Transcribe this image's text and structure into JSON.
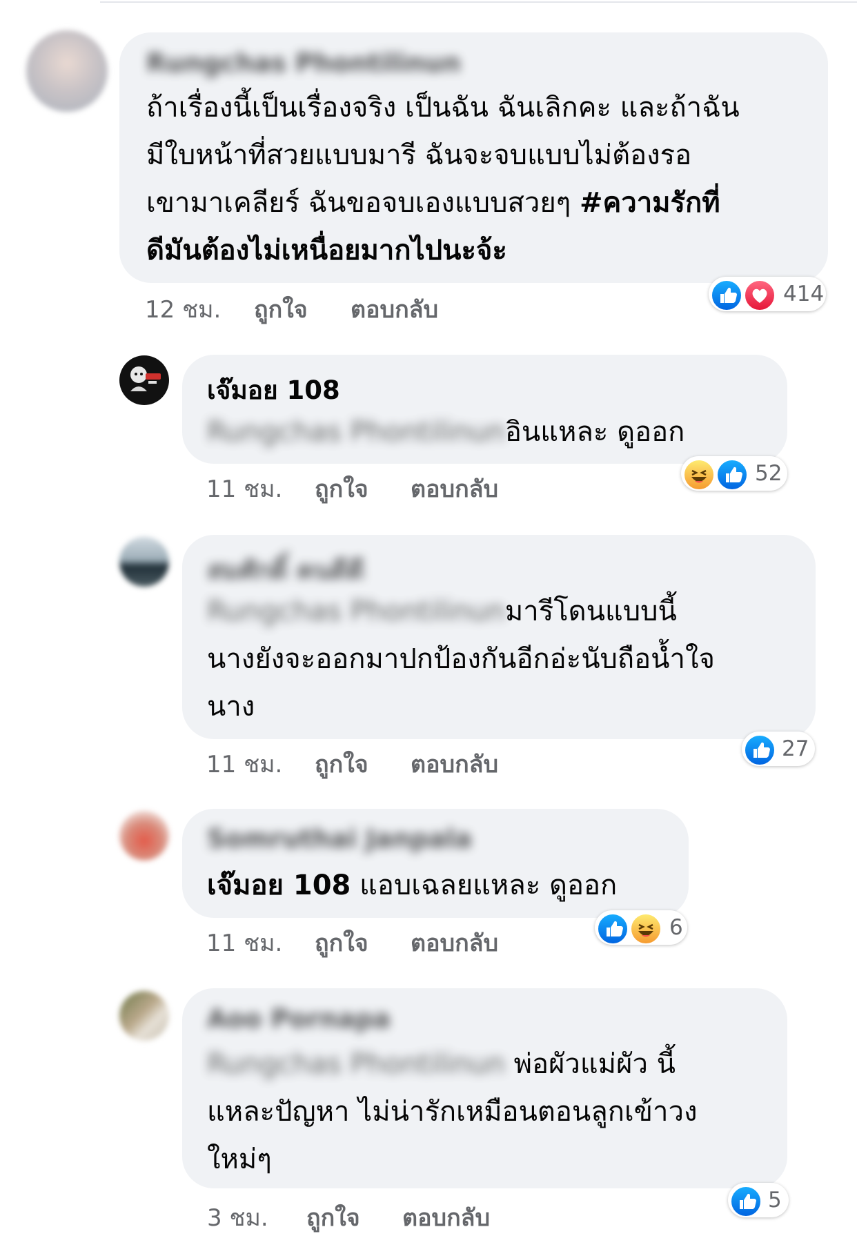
{
  "comments": [
    {
      "author": "Rungchas Phontilinun",
      "text_lines": [
        "ถ้าเรื่องนี้เป็นเรื่องจริง เป็นฉัน ฉันเลิกคะ และถ้าฉัน",
        "มีใบหน้าที่สวยแบบมารี ฉันจะจบแบบไม่ต้องรอ",
        "เขามาเคลียร์ ฉันขอจบเองแบบสวยๆ "
      ],
      "hashtag_line1": "#ความรักที่",
      "hashtag_line2": "ดีมันต้องไม่เหนื่อยมากไปนะจ้ะ",
      "time": "12 ชม.",
      "like": "ถูกใจ",
      "reply": "ตอบกลับ",
      "reactions": [
        "like-icon",
        "love-icon"
      ],
      "count": "414"
    },
    {
      "author": "เจ๊มอย 108",
      "mention": "Rungchas Phontilinun",
      "text": "อินแหละ ดูออก",
      "time": "11 ชม.",
      "like": "ถูกใจ",
      "reply": "ตอบกลับ",
      "reactions": [
        "haha-icon",
        "like-icon"
      ],
      "count": "52"
    },
    {
      "author": "สมศักดิ์ คนดีดี",
      "mention": "Rungchas Phontilinun",
      "text_first": "มารีโดนแบบนี้",
      "text_lines": [
        "นางยังจะออกมาปกป้องกันอีกอ่ะนับถือน้ำใจ",
        "นาง"
      ],
      "time": "11 ชม.",
      "like": "ถูกใจ",
      "reply": "ตอบกลับ",
      "reactions": [
        "like-icon"
      ],
      "count": "27"
    },
    {
      "author": "Somruthai Janpala",
      "mention": "เจ๊มอย 108",
      "text": " แอบเฉลยแหละ ดูออก",
      "time": "11 ชม.",
      "like": "ถูกใจ",
      "reply": "ตอบกลับ",
      "reactions": [
        "like-icon",
        "haha-icon"
      ],
      "count": "6"
    },
    {
      "author": "Aoo Pornapa",
      "mention": "Rungchas Phontilinun",
      "text_first": " พ่อผัวแม่ผัว นี้",
      "text_lines": [
        "แหละปัญหา  ไม่น่ารักเหมือนตอนลูกเข้าวง",
        "ใหม่ๆ"
      ],
      "time": "3 ชม.",
      "like": "ถูกใจ",
      "reply": "ตอบกลับ",
      "reactions": [
        "like-icon"
      ],
      "count": "5"
    }
  ],
  "colors": {
    "bubble": "#f0f2f5",
    "meta_text": "#65676b",
    "like_blue": "#1877f2",
    "love_red": "#f33e58",
    "haha_yellow": "#f7b125"
  }
}
